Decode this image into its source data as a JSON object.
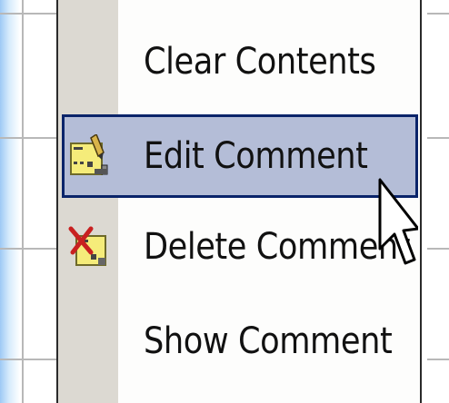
{
  "context_menu": {
    "items": [
      {
        "label": "Clear Contents",
        "icon": null
      },
      {
        "label": "Edit Comment",
        "icon": "edit-comment-icon",
        "selected": true
      },
      {
        "label": "Delete Comment",
        "icon": "delete-comment-icon"
      },
      {
        "label": "Show Comment",
        "icon": null
      }
    ]
  },
  "colors": {
    "highlight_fill": "#b4bdd7",
    "highlight_border": "#0a246a",
    "gutter": "#dcd9d2",
    "menu_bg": "#fdfdfc"
  }
}
